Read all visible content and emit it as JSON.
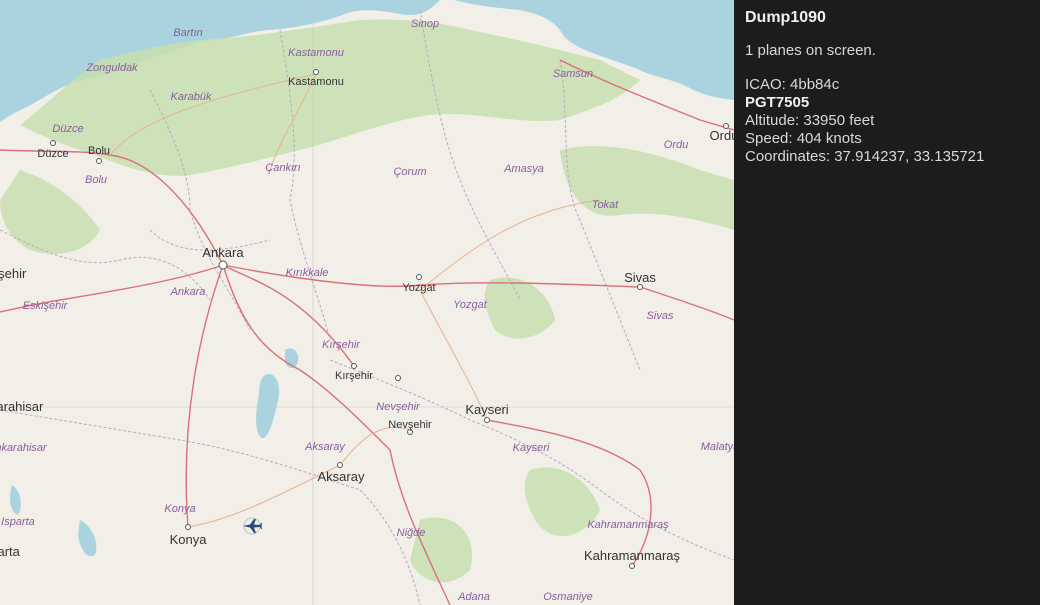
{
  "app": {
    "title": "Dump1090",
    "planes_on_screen": "1 planes on screen."
  },
  "selected_plane": {
    "icao_line": "ICAO: 4bb84c",
    "callsign": "PGT7505",
    "altitude_line": "Altitude: 33950 feet",
    "speed_line": "Speed: 404 knots",
    "coordinates_line": "Coordinates: 37.914237, 33.135721"
  },
  "map": {
    "water_color": "#aad3df",
    "land_color": "#f2efe9",
    "forest_color": "#c8dfb0",
    "road_color": "#d9707a",
    "province_labels": [
      "Bartın",
      "Sinop",
      "Zonguldak",
      "Kastamonu",
      "Samsun",
      "Karabük",
      "Düzce",
      "Bolu",
      "Çankırı",
      "Çorum",
      "Amasya",
      "Ordu",
      "Tokat",
      "Kırıkkale",
      "Yozgat",
      "Eskişehir",
      "Ankara",
      "Sivas",
      "Kırşehir",
      "Nevşehir",
      "Aksaray",
      "Kayseri",
      "Malatya",
      "Konya",
      "Kahramanmaraş",
      "Niğde",
      "Adana",
      "Osmaniye",
      "Afyonkarahisar",
      "Isparta"
    ],
    "city_labels": [
      "Kastamonu",
      "Düzce",
      "Bolu",
      "Ankara",
      "Yozgat",
      "Sivas",
      "Kırşehir",
      "Nevşehir",
      "Kayseri",
      "Aksaray",
      "Konya",
      "Kahramanmaraş",
      "Ordu",
      "Eskişehir",
      "Afyonkarahisar",
      "Isparta"
    ],
    "plane_icon": "airplane-icon"
  }
}
